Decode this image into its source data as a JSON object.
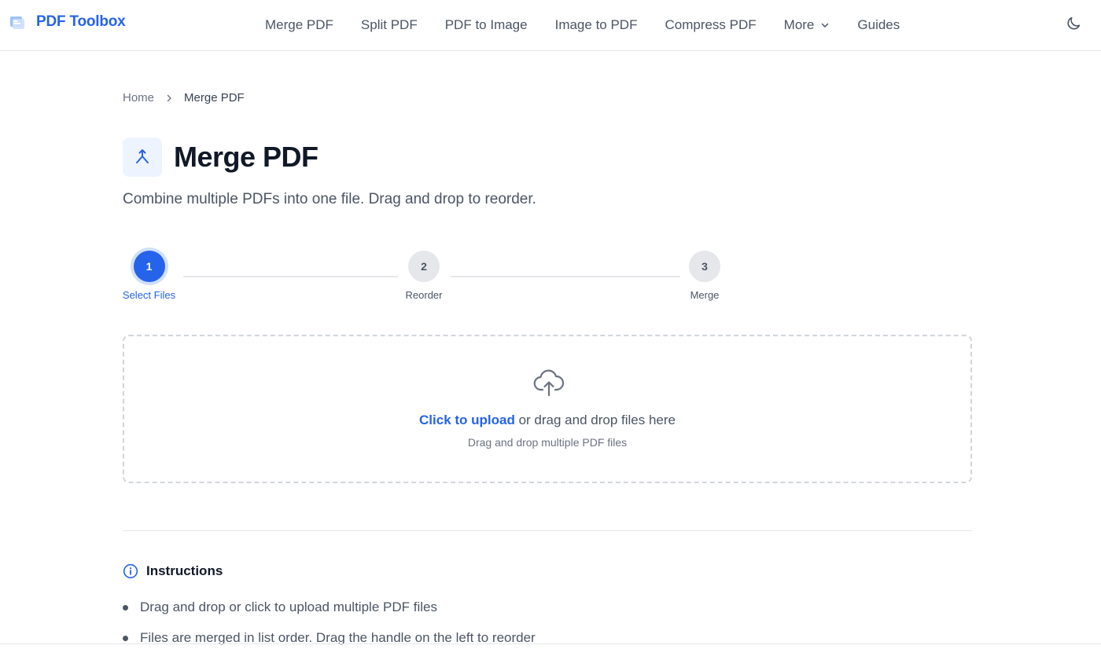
{
  "brand": {
    "name": "PDF Toolbox",
    "logo_icon": "pdf-logo-icon",
    "color": "#2563eb"
  },
  "nav": {
    "items": [
      {
        "label": "Merge PDF"
      },
      {
        "label": "Split PDF"
      },
      {
        "label": "PDF to Image"
      },
      {
        "label": "Image to PDF"
      },
      {
        "label": "Compress PDF"
      },
      {
        "label": "More",
        "icon": "chevron-down-icon"
      },
      {
        "label": "Guides"
      }
    ],
    "theme_toggle_icon": "moon-icon"
  },
  "breadcrumb": {
    "home": "Home",
    "current": "Merge PDF"
  },
  "page": {
    "title": "Merge PDF",
    "title_icon": "merge-icon",
    "subtitle": "Combine multiple PDFs into one file. Drag and drop to reorder."
  },
  "stepper": {
    "steps": [
      {
        "number": "1",
        "label": "Select Files",
        "state": "active"
      },
      {
        "number": "2",
        "label": "Reorder",
        "state": "idle"
      },
      {
        "number": "3",
        "label": "Merge",
        "state": "idle"
      }
    ]
  },
  "dropzone": {
    "icon": "cloud-upload-icon",
    "link_text": "Click to upload",
    "main_text": " or drag and drop files here",
    "hint": "Drag and drop multiple PDF files"
  },
  "instructions": {
    "title": "Instructions",
    "icon": "info-icon",
    "items": [
      "Drag and drop or click to upload multiple PDF files",
      "Files are merged in list order. Drag the handle on the left to reorder"
    ]
  },
  "colors": {
    "accent": "#2563eb",
    "text": "#111827",
    "muted": "#4b5563",
    "border": "#e5e7eb"
  }
}
